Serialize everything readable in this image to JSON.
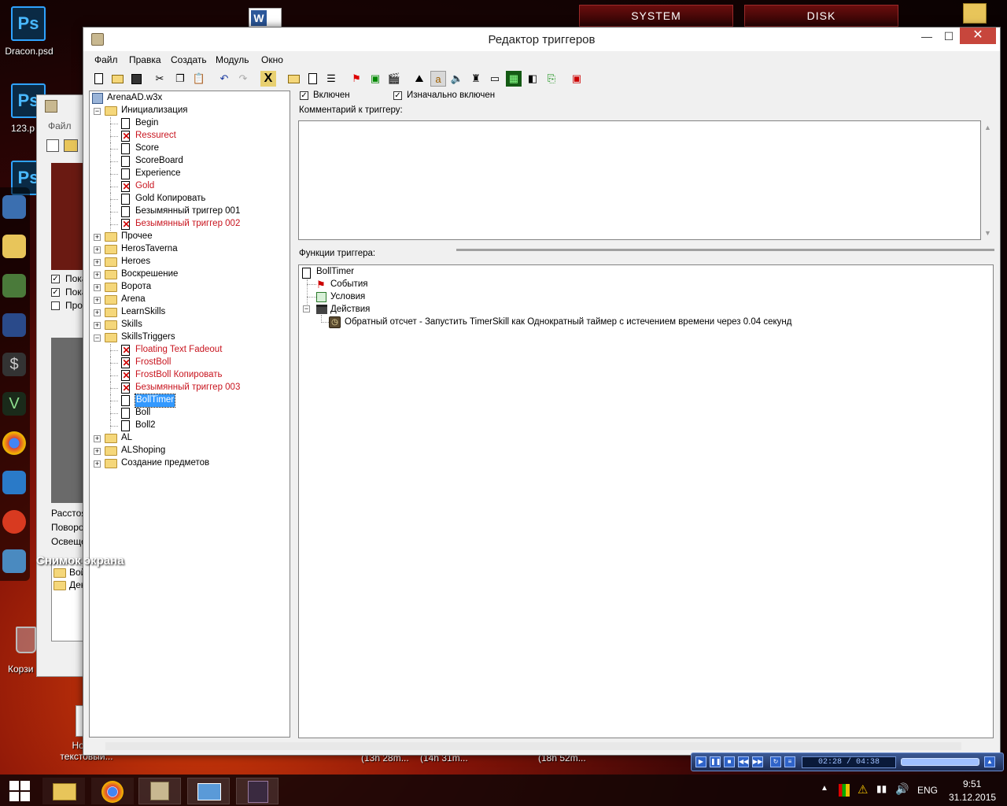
{
  "desktop": {
    "icons": [
      {
        "label": "Dracon.psd",
        "glyph": "Ps"
      },
      {
        "label": "123.p",
        "glyph": "Ps"
      },
      {
        "label": "",
        "glyph": "Ps"
      },
      {
        "label": "Корзи",
        "glyph": "recycle-bin"
      },
      {
        "label": "Новый текстовый...",
        "glyph": "text-file"
      }
    ],
    "gadget_system": "SYSTEM",
    "gadget_disk": "DISK",
    "snapshot_label": "Снимок экрана",
    "task_timers": [
      "(13h 28m...",
      "(14h 31m...",
      "(18h 52m..."
    ]
  },
  "bg_window": {
    "menu": "Файл",
    "checks": [
      {
        "label": "Пока",
        "checked": true
      },
      {
        "label": "Пока",
        "checked": true
      },
      {
        "label": "Прос",
        "checked": false
      }
    ],
    "fields": [
      "Расстоя",
      "Поворот",
      "Освеще"
    ],
    "folders": [
      "Вой",
      "Дек"
    ]
  },
  "window": {
    "title": "Редактор триггеров",
    "minimize": "—",
    "maximize": "☐",
    "close": "✕",
    "menu": [
      "Файл",
      "Правка",
      "Создать",
      "Модуль",
      "Окно"
    ]
  },
  "tree": {
    "root": "ArenaAD.w3x",
    "items": [
      {
        "label": "Инициализация",
        "type": "folder",
        "expanded": true,
        "level": 0
      },
      {
        "label": "Begin",
        "type": "trigger",
        "level": 1
      },
      {
        "label": "Ressurect",
        "type": "trigger-disabled",
        "level": 1
      },
      {
        "label": "Score",
        "type": "trigger",
        "level": 1
      },
      {
        "label": "ScoreBoard",
        "type": "trigger",
        "level": 1
      },
      {
        "label": "Experience",
        "type": "trigger",
        "level": 1
      },
      {
        "label": "Gold",
        "type": "trigger-disabled",
        "level": 1
      },
      {
        "label": "Gold Копировать",
        "type": "trigger",
        "level": 1
      },
      {
        "label": "Безымянный триггер 001",
        "type": "trigger",
        "level": 1
      },
      {
        "label": "Безымянный триггер 002",
        "type": "trigger-disabled",
        "level": 1
      },
      {
        "label": "Прочее",
        "type": "folder",
        "expanded": false,
        "level": 0
      },
      {
        "label": "HerosTaverna",
        "type": "folder",
        "expanded": false,
        "level": 0
      },
      {
        "label": "Heroes",
        "type": "folder",
        "expanded": false,
        "level": 0
      },
      {
        "label": "Воскрешение",
        "type": "folder",
        "expanded": false,
        "level": 0
      },
      {
        "label": "Ворота",
        "type": "folder",
        "expanded": false,
        "level": 0
      },
      {
        "label": "Arena",
        "type": "folder",
        "expanded": false,
        "level": 0
      },
      {
        "label": "LearnSkills",
        "type": "folder",
        "expanded": false,
        "level": 0
      },
      {
        "label": "Skills",
        "type": "folder",
        "expanded": false,
        "level": 0
      },
      {
        "label": "SkillsTriggers",
        "type": "folder",
        "expanded": true,
        "level": 0
      },
      {
        "label": "Floating Text Fadeout",
        "type": "trigger-disabled",
        "level": 1
      },
      {
        "label": "FrostBoll",
        "type": "trigger-disabled",
        "level": 1
      },
      {
        "label": "FrostBoll Копировать",
        "type": "trigger-disabled",
        "level": 1
      },
      {
        "label": "Безымянный триггер 003",
        "type": "trigger-disabled",
        "level": 1
      },
      {
        "label": "BollTimer",
        "type": "trigger",
        "level": 1,
        "selected": true
      },
      {
        "label": "Boll",
        "type": "trigger",
        "level": 1
      },
      {
        "label": "Boll2",
        "type": "trigger",
        "level": 1
      },
      {
        "label": "AL",
        "type": "folder",
        "expanded": false,
        "level": 0
      },
      {
        "label": "ALShoping",
        "type": "folder",
        "expanded": false,
        "level": 0
      },
      {
        "label": "Создание предметов",
        "type": "folder",
        "expanded": false,
        "level": 0
      }
    ]
  },
  "options": {
    "enabled_label": "Включен",
    "enabled": true,
    "initially_on_label": "Изначально включен",
    "initially_on": true,
    "comment_label": "Комментарий к триггеру:",
    "comment_value": ""
  },
  "functions": {
    "label": "Функции триггера:",
    "trigger_name": "BollTimer",
    "events": "События",
    "conditions": "Условия",
    "actions": "Действия",
    "action_items": [
      "Обратный отсчет - Запустить TimerSkill как Однократный таймер с истечением времени через 0.04 секунд"
    ]
  },
  "media_player": {
    "time": "02:28 / 04:38"
  },
  "tray": {
    "lang": "ENG",
    "time": "9:51",
    "date": "31.12.2015"
  },
  "colors": {
    "disabled_trigger": "#c8141e",
    "selection": "#3399ff",
    "close_button": "#c7463c"
  }
}
